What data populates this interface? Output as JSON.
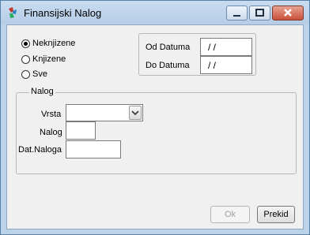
{
  "window": {
    "title": "Finansijski Nalog"
  },
  "status_filter": {
    "options": [
      "Neknjizene",
      "Knjizene",
      "Sve"
    ],
    "selected": "Neknjizene"
  },
  "dates": {
    "from_label": "Od Datuma",
    "from_value": " / /",
    "to_label": "Do Datuma",
    "to_value": " / /"
  },
  "nalog_group": {
    "title": "Nalog",
    "vrsta_label": "Vrsta",
    "vrsta_value": "",
    "nalog_label": "Nalog",
    "nalog_value": "",
    "dat_label": "Dat.Naloga",
    "dat_value": ""
  },
  "buttons": {
    "ok": "Ok",
    "cancel": "Prekid"
  },
  "icons": [
    "app-icon",
    "minimize-icon",
    "maximize-icon",
    "close-icon",
    "chevron-down-icon"
  ]
}
